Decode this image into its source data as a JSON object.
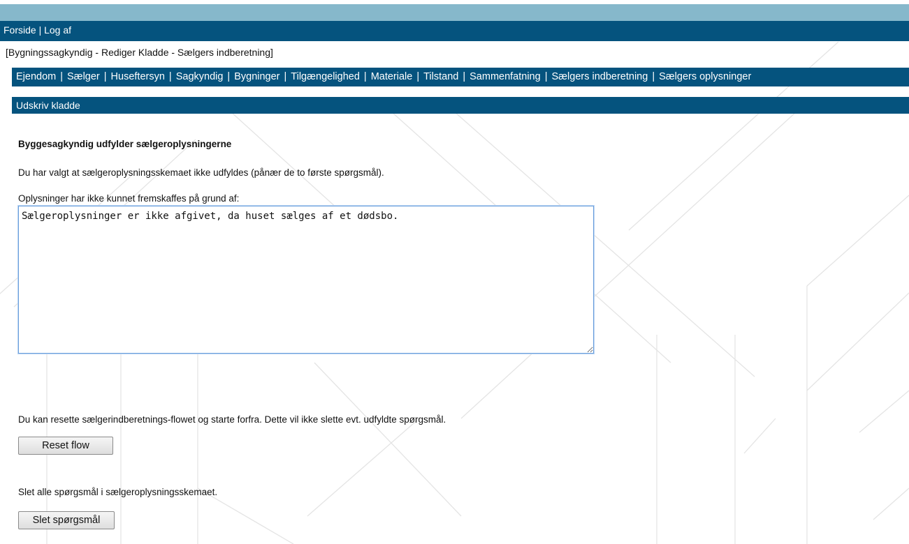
{
  "header": {
    "links": [
      {
        "label": "Forside"
      },
      {
        "label": "Log af"
      }
    ],
    "separator": "|"
  },
  "breadcrumb": "[Bygningssagkyndig - Rediger Kladde - Sælgers indberetning]",
  "nav": {
    "separator": "|",
    "items": [
      {
        "label": "Ejendom"
      },
      {
        "label": "Sælger"
      },
      {
        "label": "Huseftersyn"
      },
      {
        "label": "Sagkyndig"
      },
      {
        "label": "Bygninger"
      },
      {
        "label": "Tilgængelighed"
      },
      {
        "label": "Materiale"
      },
      {
        "label": "Tilstand"
      },
      {
        "label": "Sammenfatning"
      },
      {
        "label": "Sælgers indberetning",
        "active": true
      },
      {
        "label": "Sælgers oplysninger"
      }
    ]
  },
  "print_bar": {
    "label": "Udskriv kladde"
  },
  "content": {
    "heading": "Byggesagkyndig udfylder sælgeroplysningerne",
    "info": "Du har valgt at sælgeroplysningsskemaet ikke udfyldes (pånær de to første spørgsmål).",
    "reason_label": "Oplysninger har ikke kunnet fremskaffes på grund af:",
    "reason_value": "Sælgeroplysninger er ikke afgivet, da huset sælges af et dødsbo.",
    "reset_text": "Du kan resette sælgerindberetnings-flowet og starte forfra. Dette vil ikke slette evt. udfyldte spørgsmål.",
    "reset_button": "Reset flow",
    "delete_text": "Slet alle spørgsmål i sælgeroplysningsskemaet.",
    "delete_button": "Slet spørgsmål"
  },
  "colors": {
    "bar": "#05537e",
    "top_band": "#86b8cb",
    "active_link": "#1a1aff"
  }
}
